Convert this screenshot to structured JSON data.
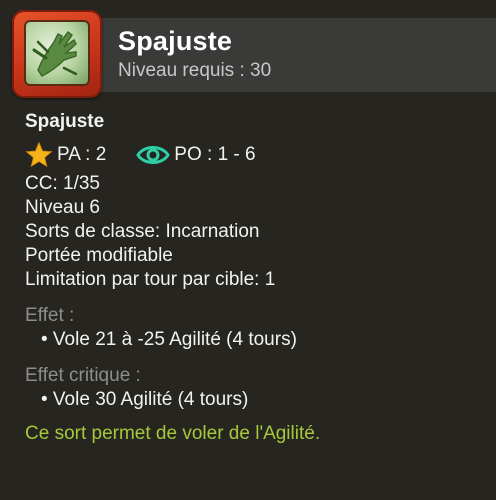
{
  "header": {
    "title": "Spajuste",
    "subtitle": "Niveau requis : 30"
  },
  "spell": {
    "name": "Spajuste",
    "pa_label": "PA : 2",
    "po_label": "PO : 1 - 6",
    "details": [
      "CC: 1/35",
      "Niveau 6",
      "Sorts de classe: Incarnation",
      "Portée modifiable",
      "Limitation par tour par cible: 1"
    ],
    "effect_label": "Effet :",
    "effect_items": [
      "• Vole 21 à -25 Agilité (4 tours)"
    ],
    "critical_label": "Effet critique :",
    "critical_items": [
      "• Vole 30 Agilité (4 tours)"
    ],
    "description": "Ce sort permet de voler de l'Agilité."
  },
  "icons": {
    "pa": "star-icon",
    "po": "eye-icon",
    "spell": "hand-spell-icon"
  },
  "colors": {
    "background": "#262520",
    "header_band": "#3a3a38",
    "star": "#f5b21a",
    "eye": "#2fcfa6",
    "muted_label": "#8d8d8d",
    "description": "#a6c83a"
  }
}
